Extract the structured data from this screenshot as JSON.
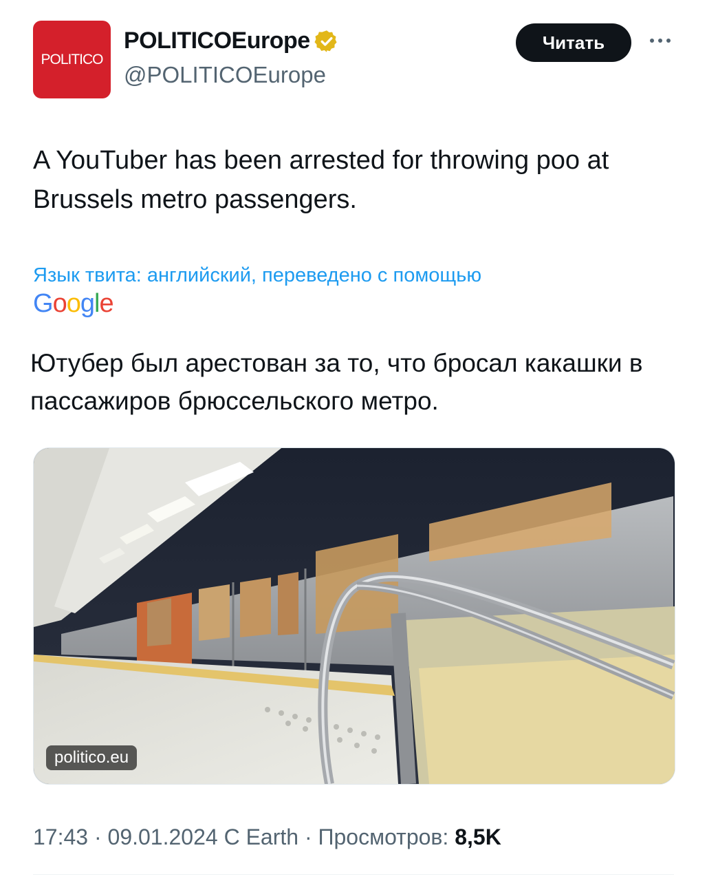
{
  "header": {
    "avatar_text": "POLITICO",
    "display_name": "POLITICOEurope",
    "handle": "@POLITICOEurope",
    "follow_label": "Читать",
    "verified_color": "#e2b719"
  },
  "tweet": {
    "text": "A YouTuber has been arrested for throwing poo at Brussels metro passengers.",
    "translation_note": "Язык твита: английский, переведено с помощью",
    "translation_provider": "Google",
    "translated_text": "Ютубер был арестован за то, что бросал какашки в пассажиров брюссельского метро."
  },
  "media": {
    "domain_label": "politico.eu"
  },
  "meta": {
    "time": "17:43",
    "date": "09.01.2024",
    "source": "С Earth",
    "views_label": "Просмотров:",
    "views_count": "8,5K"
  },
  "colors": {
    "accent_link": "#1d9bf0",
    "brand_red": "#d4202b",
    "secondary_text": "#536471"
  }
}
